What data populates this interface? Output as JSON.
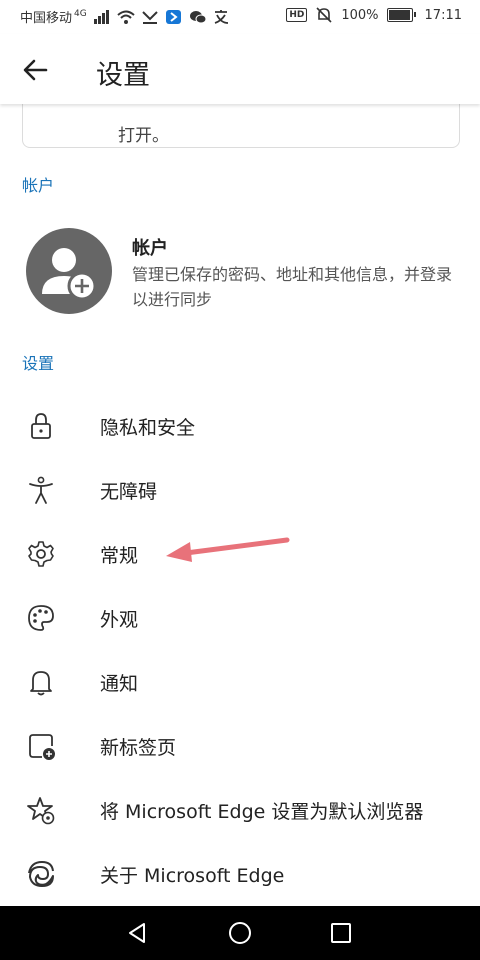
{
  "status_bar": {
    "carrier": "中国移动",
    "network": "4G",
    "battery": "100%",
    "battery_level": 1.0,
    "time": "17:11"
  },
  "app_bar": {
    "title": "设置",
    "back_icon": "arrow-left-icon"
  },
  "prev_card": {
    "text": "打开。"
  },
  "account_section": {
    "header": "帐户",
    "item": {
      "name": "帐户",
      "description": "管理已保存的密码、地址和其他信息，并登录以进行同步",
      "icon": "avatar-add-icon"
    }
  },
  "settings_section": {
    "header": "设置",
    "items": [
      {
        "label": "隐私和安全",
        "icon": "lock-icon"
      },
      {
        "label": "无障碍",
        "icon": "accessibility-icon"
      },
      {
        "label": "常规",
        "icon": "gear-icon"
      },
      {
        "label": "外观",
        "icon": "palette-icon"
      },
      {
        "label": "通知",
        "icon": "bell-icon"
      },
      {
        "label": "新标签页",
        "icon": "new-tab-icon"
      },
      {
        "label": "将 Microsoft Edge 设置为默认浏览器",
        "icon": "star-gear-icon"
      },
      {
        "label": "关于 Microsoft Edge",
        "icon": "edge-logo-icon"
      }
    ]
  },
  "annotation": {
    "type": "arrow",
    "color": "#e8727a",
    "points_to": "常规"
  },
  "nav_bar": {
    "back": "triangle-back-icon",
    "home": "circle-home-icon",
    "recents": "square-recents-icon"
  }
}
